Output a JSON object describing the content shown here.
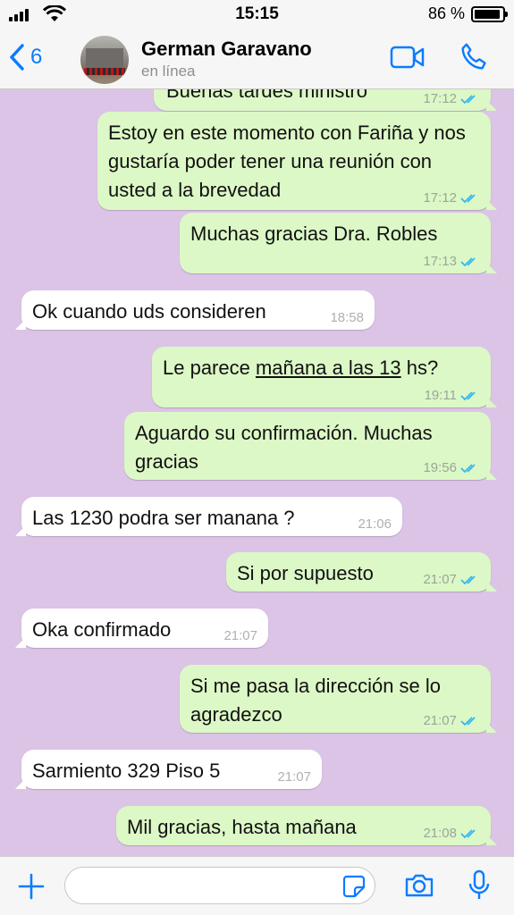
{
  "status_bar": {
    "time": "15:15",
    "battery": "86 %"
  },
  "header": {
    "back_count": "6",
    "contact_name": "German Garavano",
    "contact_status": "en línea"
  },
  "messages": [
    {
      "type": "out",
      "text": "Buenas tardes ministro",
      "time": "17:12"
    },
    {
      "type": "out",
      "text": "Estoy en este momento con Fariña y nos gustaría poder tener una reunión con usted a la brevedad",
      "time": "17:12"
    },
    {
      "type": "out",
      "text": "Muchas gracias Dra. Robles",
      "time": "17:13"
    },
    {
      "type": "in",
      "text": "Ok cuando uds consideren",
      "time": "18:58"
    },
    {
      "type": "out",
      "text_prefix": "Le parece ",
      "text_link": "mañana a las 13",
      "text_suffix": " hs?",
      "time": "19:11"
    },
    {
      "type": "out",
      "text": "Aguardo su confirmación. Muchas gracias",
      "time": "19:56"
    },
    {
      "type": "in",
      "text": "Las 1230 podra ser manana ?",
      "time": "21:06"
    },
    {
      "type": "out",
      "text": "Si por supuesto",
      "time": "21:07"
    },
    {
      "type": "in",
      "text": "Oka confirmado",
      "time": "21:07"
    },
    {
      "type": "out",
      "text": "Si me pasa la dirección se lo agradezco",
      "time": "21:07"
    },
    {
      "type": "in",
      "text": "Sarmiento 329 Piso 5",
      "time": "21:07"
    },
    {
      "type": "out",
      "text": "Mil gracias, hasta mañana",
      "time": "21:08"
    }
  ],
  "input_bar": {
    "placeholder": ""
  },
  "colors": {
    "accent": "#0a7cff",
    "chat_background": "#dcc4e6",
    "outgoing_bubble": "#dcf8c6",
    "incoming_bubble": "#ffffff",
    "read_tick": "#34b7f1"
  },
  "icons": [
    "signal-icon",
    "wifi-icon",
    "battery-icon",
    "back-chevron-icon",
    "video-call-icon",
    "phone-icon",
    "read-receipt-icon",
    "plus-icon",
    "sticker-icon",
    "camera-icon",
    "microphone-icon"
  ]
}
